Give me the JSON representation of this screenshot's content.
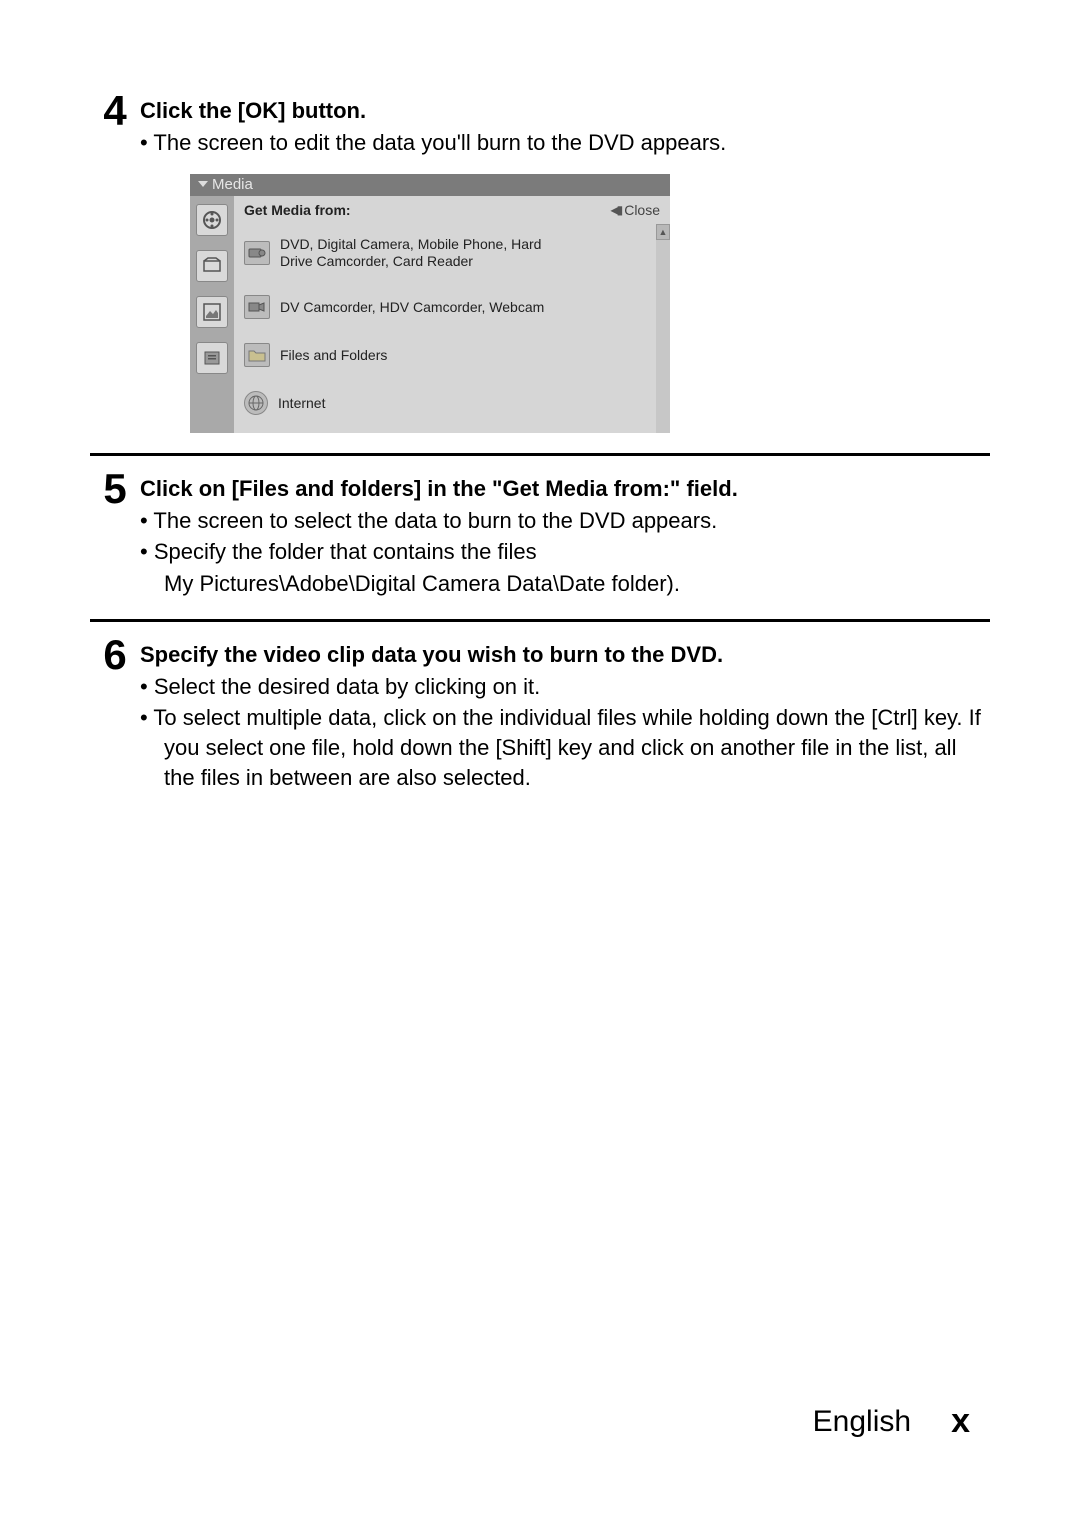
{
  "steps": [
    {
      "num": "4",
      "title": "Click the [OK] button.",
      "bullets": [
        "The screen to edit the data you'll burn to the DVD appears."
      ]
    },
    {
      "num": "5",
      "title": "Click on [Files and folders] in the \"Get Media from:\" field.",
      "bullets": [
        "The screen to select the data to burn to the DVD appears.",
        "Specify the folder that contains the files"
      ],
      "sublines": [
        "My Pictures\\Adobe\\Digital Camera Data\\Date folder)."
      ]
    },
    {
      "num": "6",
      "title": "Specify the video clip data you wish to burn to the DVD.",
      "bullets": [
        "Select the desired data by clicking on it.",
        "To select multiple data, click on the individual files while holding down the [Ctrl] key. If you select one file, hold down the [Shift] key and click on another file in the list, all the files in between are also selected."
      ]
    }
  ],
  "panel": {
    "title": "Media",
    "header_label": "Get Media from:",
    "close_label": "Close",
    "items": [
      "DVD, Digital Camera, Mobile Phone, Hard Drive Camcorder, Card Reader",
      "DV Camcorder, HDV Camcorder, Webcam",
      "Files and Folders",
      "Internet"
    ]
  },
  "footer": {
    "lang": "English",
    "page": "x"
  }
}
